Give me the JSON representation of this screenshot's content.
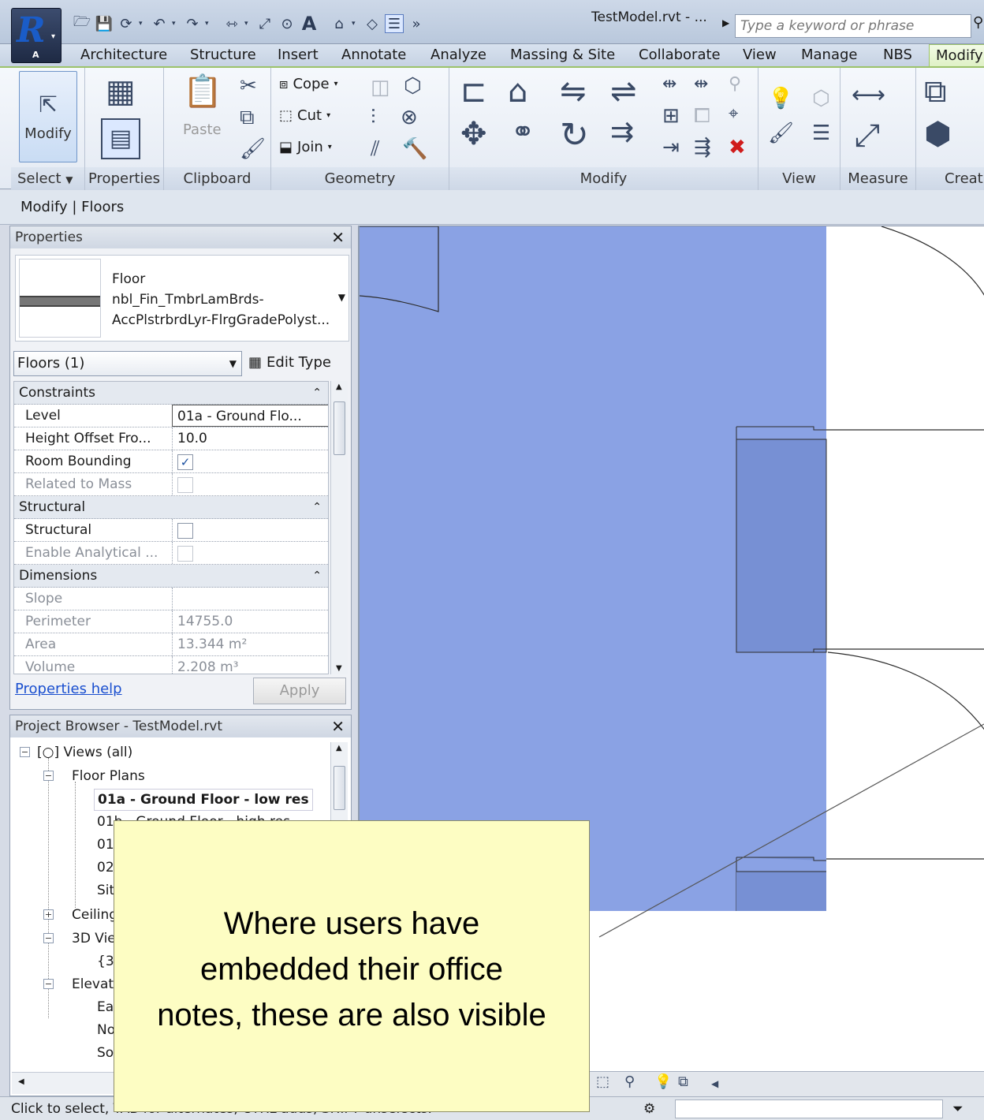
{
  "titlebar": {
    "document_title": "TestModel.rvt - ...",
    "search_placeholder": "Type a keyword or phrase",
    "app_badge": "A",
    "text_tool": "A"
  },
  "tabs": [
    "Architecture",
    "Structure",
    "Insert",
    "Annotate",
    "Analyze",
    "Massing & Site",
    "Collaborate",
    "View",
    "Manage",
    "NBS",
    "Modify"
  ],
  "ribbon": {
    "modify_label": "Modify",
    "paste_label": "Paste",
    "cope_label": "Cope",
    "cut_label": "Cut",
    "join_label": "Join",
    "panels": {
      "select": "Select",
      "properties": "Properties",
      "clipboard": "Clipboard",
      "geometry": "Geometry",
      "modify": "Modify",
      "view": "View",
      "measure": "Measure",
      "create": "Creat"
    }
  },
  "context_bar": "Modify | Floors",
  "properties": {
    "title": "Properties",
    "type_family": "Floor",
    "type_name_1": "nbl_Fin_TmbrLamBrds-",
    "type_name_2": "AccPlstrbrdLyr-FlrgGradePolyst...",
    "instance_selector": "Floors (1)",
    "edit_type": "Edit Type",
    "groups": {
      "constraints": "Constraints",
      "structural": "Structural",
      "dimensions": "Dimensions"
    },
    "rows": {
      "level": {
        "key": "Level",
        "value": "01a - Ground Flo..."
      },
      "height_offset": {
        "key": "Height Offset Fro...",
        "value": "10.0"
      },
      "room_bounding": {
        "key": "Room Bounding",
        "checked": true
      },
      "related_mass": {
        "key": "Related to Mass",
        "checked": false
      },
      "structural": {
        "key": "Structural",
        "checked": false
      },
      "analytical": {
        "key": "Enable Analytical ...",
        "checked": false
      },
      "slope": {
        "key": "Slope",
        "value": ""
      },
      "perimeter": {
        "key": "Perimeter",
        "value": "14755.0"
      },
      "area": {
        "key": "Area",
        "value": "13.344 m²"
      },
      "volume": {
        "key": "Volume",
        "value": "2.208 m³"
      }
    },
    "help_link": "Properties help",
    "apply": "Apply"
  },
  "browser": {
    "title": "Project Browser - TestModel.rvt",
    "views_all": "Views (all)",
    "floor_plans": "Floor Plans",
    "selected_view": "01a - Ground Floor - low res",
    "fp_item_2": "01b - Ground Floor - high res",
    "fp_item_3": "01",
    "fp_item_4": "02",
    "fp_item_5": "Sit",
    "ceiling": "Ceiling",
    "views3d": "3D Vie",
    "view3d_item": "{3",
    "elevations": "Elevat",
    "elev_1": "Ea",
    "elev_2": "No",
    "elev_3": "So"
  },
  "status_text": "Click to select, TAB for alternates, CTRL adds, SHIFT unselects.",
  "callout_text": "Where users have\nembedded their office\nnotes, these are also visible",
  "colors": {
    "floor_fill": "#8aa2e4",
    "floor_dark": "#7790d4",
    "callout_bg": "#fdfdc3",
    "ribbon_accent": "#9cc26a"
  }
}
